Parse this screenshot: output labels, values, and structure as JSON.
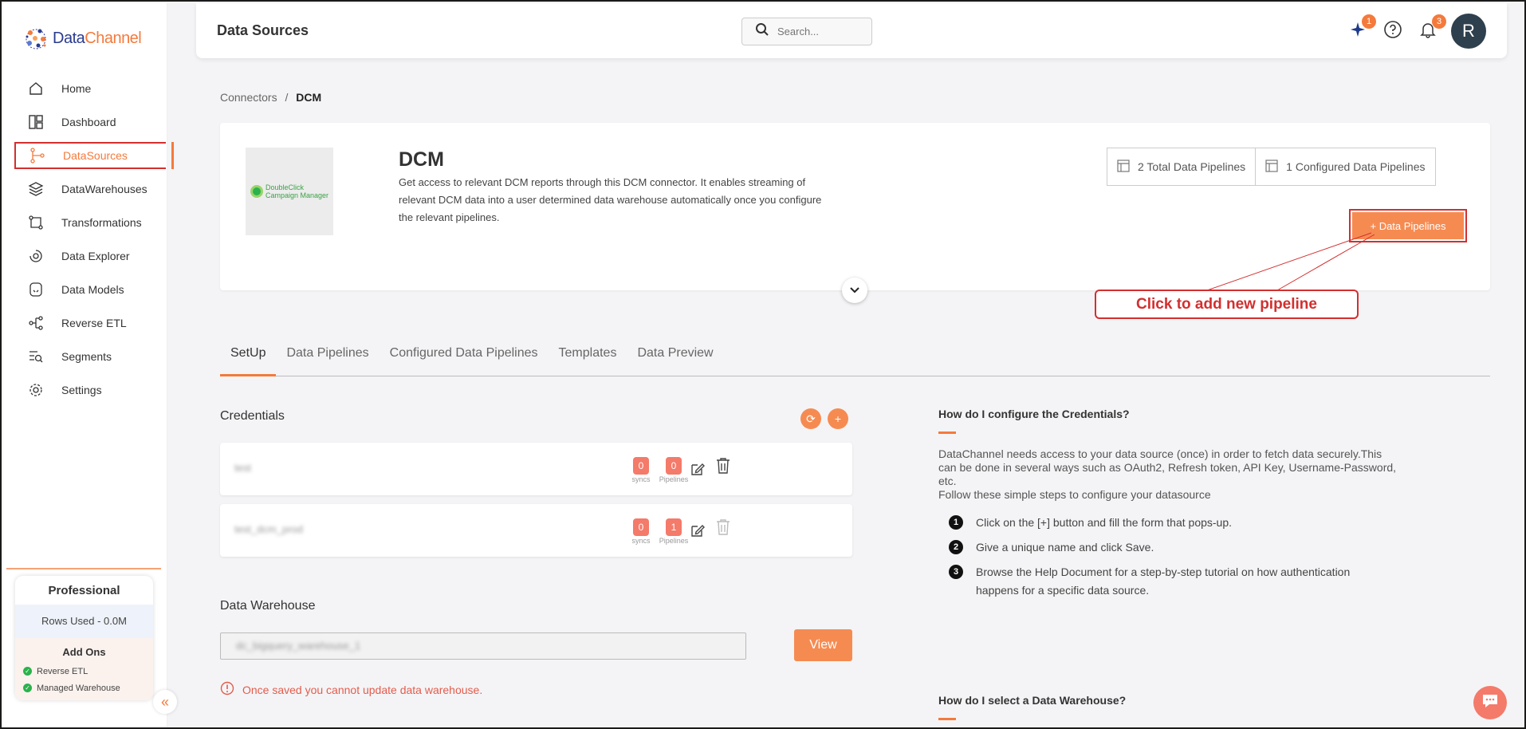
{
  "brand": {
    "name_part1": "Data",
    "name_part2": "Channel"
  },
  "sidebar": {
    "items": [
      {
        "label": "Home",
        "icon": "home-icon"
      },
      {
        "label": "Dashboard",
        "icon": "dashboard-icon"
      },
      {
        "label": "DataSources",
        "icon": "datasources-icon"
      },
      {
        "label": "DataWarehouses",
        "icon": "layers-icon"
      },
      {
        "label": "Transformations",
        "icon": "transform-icon"
      },
      {
        "label": "Data Explorer",
        "icon": "explorer-icon"
      },
      {
        "label": "Data Models",
        "icon": "models-icon"
      },
      {
        "label": "Reverse ETL",
        "icon": "reverse-etl-icon"
      },
      {
        "label": "Segments",
        "icon": "segments-icon"
      },
      {
        "label": "Settings",
        "icon": "gear-icon"
      }
    ],
    "active_index": 2,
    "plan": {
      "name": "Professional",
      "rows_used": "Rows Used - 0.0M",
      "addons_title": "Add Ons",
      "addons": [
        "Reverse ETL",
        "Managed Warehouse"
      ]
    }
  },
  "header": {
    "title": "Data Sources",
    "search_placeholder": "Search...",
    "ai_badge": "1",
    "notif_badge": "3",
    "avatar_initial": "R"
  },
  "breadcrumb": {
    "parent": "Connectors",
    "separator": "/",
    "current": "DCM"
  },
  "connector": {
    "title": "DCM",
    "logo_text_1": "DoubleClick",
    "logo_text_2": "Campaign Manager",
    "description_lines": [
      "Get access to relevant DCM reports through this DCM connector. It enables streaming of",
      "relevant DCM data into a user determined data warehouse automatically once you configure",
      "the relevant pipelines."
    ],
    "total_pipelines": "2 Total Data Pipelines",
    "configured_pipelines": "1 Configured Data Pipelines",
    "add_pipeline_label": "+ Data Pipelines"
  },
  "annotation": {
    "callout": "Click to add new pipeline"
  },
  "tabs": [
    "SetUp",
    "Data Pipelines",
    "Configured Data Pipelines",
    "Templates",
    "Data Preview"
  ],
  "credentials": {
    "title": "Credentials",
    "rows": [
      {
        "name": "test",
        "syncs": "0",
        "pipelines": "0",
        "delete_enabled": true
      },
      {
        "name": "test_dcm_prod",
        "syncs": "0",
        "pipelines": "1",
        "delete_enabled": false
      }
    ],
    "syncs_label": "syncs",
    "pipelines_label": "Pipelines"
  },
  "warehouse": {
    "title": "Data Warehouse",
    "value": "dc_bigquery_warehouse_1",
    "view_label": "View",
    "warning": "Once saved you cannot update data warehouse."
  },
  "help": {
    "q1": "How do I configure the Credentials?",
    "body_lines": [
      "DataChannel needs access to your data source (once) in order to fetch data securely.This",
      "can be done in several ways such as OAuth2, Refresh token, API Key, Username-Password,",
      "etc.",
      "Follow these simple steps to configure your datasource"
    ],
    "steps": [
      {
        "n": "1",
        "text": "Click on the [+] button and fill the form that pops-up."
      },
      {
        "n": "2",
        "text": "Give a unique name and click Save."
      },
      {
        "n": "3",
        "text": "Browse the Help Document for a step-by-step tutorial on how authentication happens for a specific data source."
      }
    ],
    "q2": "How do I select a Data Warehouse?"
  },
  "colors": {
    "accent": "#f47a3c",
    "annotation_red": "#d32f2f",
    "badge": "#f47a6a"
  }
}
